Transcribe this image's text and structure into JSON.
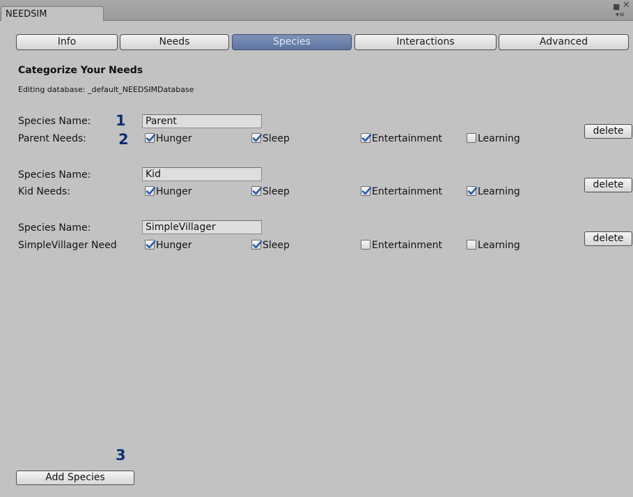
{
  "window": {
    "tab_title": "NEEDSIM"
  },
  "tabs": [
    {
      "label": "Info"
    },
    {
      "label": "Needs"
    },
    {
      "label": "Species",
      "active": true
    },
    {
      "label": "Interactions"
    },
    {
      "label": "Advanced"
    }
  ],
  "heading": "Categorize Your Needs",
  "database_line": "Editing database: _default_NEEDSIMDatabase",
  "species_name_label": "Species Name:",
  "delete_label": "delete",
  "species": [
    {
      "name": "Parent",
      "needs_label": "Parent Needs:",
      "needs": [
        {
          "label": "Hunger",
          "checked": true
        },
        {
          "label": "Sleep",
          "checked": true
        },
        {
          "label": "Entertainment",
          "checked": true
        },
        {
          "label": "Learning",
          "checked": false
        }
      ]
    },
    {
      "name": "Kid",
      "needs_label": "Kid Needs:",
      "needs": [
        {
          "label": "Hunger",
          "checked": true
        },
        {
          "label": "Sleep",
          "checked": true
        },
        {
          "label": "Entertainment",
          "checked": true
        },
        {
          "label": "Learning",
          "checked": true
        }
      ]
    },
    {
      "name": "SimpleVillager",
      "needs_label": "SimpleVillager Need",
      "needs": [
        {
          "label": "Hunger",
          "checked": true
        },
        {
          "label": "Sleep",
          "checked": true
        },
        {
          "label": "Entertainment",
          "checked": false
        },
        {
          "label": "Learning",
          "checked": false
        }
      ]
    }
  ],
  "markers": [
    "1",
    "2",
    "3"
  ],
  "add_species_label": "Add Species",
  "colors": {
    "background": "#c2c2c2",
    "active_tab": "#6a7faa",
    "marker": "#0d2f70",
    "checkmark": "#2d5bb0"
  }
}
